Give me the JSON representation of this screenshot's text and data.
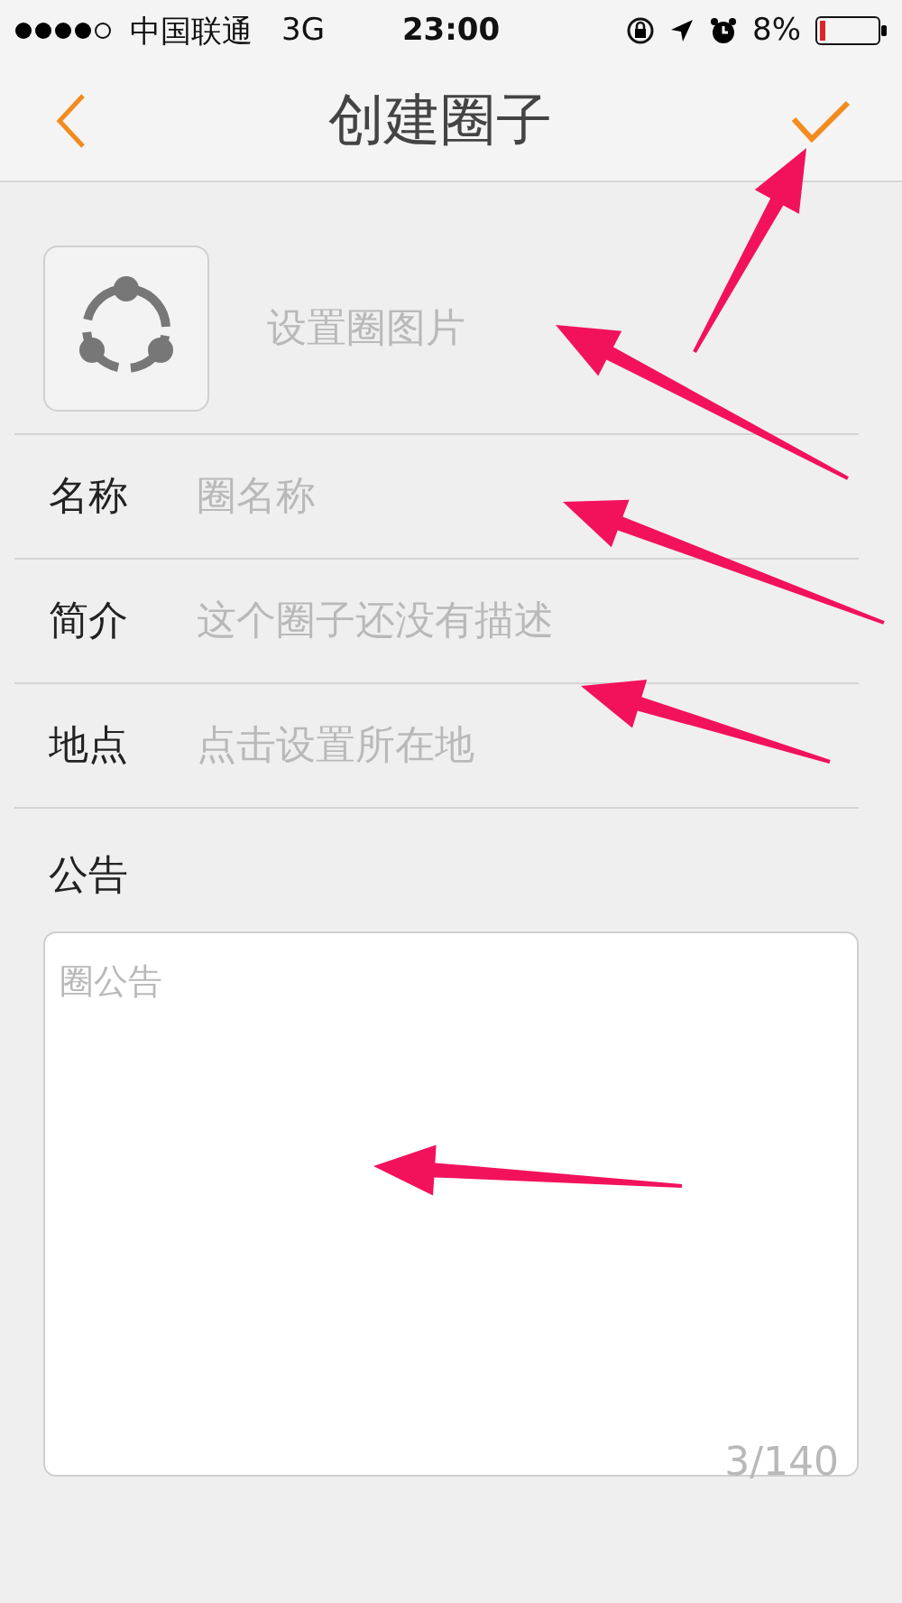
{
  "status_bar": {
    "carrier": "中国联通",
    "network": "3G",
    "time": "23:00",
    "battery": "8%"
  },
  "nav": {
    "title": "创建圈子"
  },
  "image_row": {
    "label": "设置圈图片"
  },
  "fields": [
    {
      "label": "名称",
      "placeholder": "圈名称"
    },
    {
      "label": "简介",
      "placeholder": "这个圈子还没有描述"
    },
    {
      "label": "地点",
      "placeholder": "点击设置所在地"
    }
  ],
  "notice": {
    "label": "公告",
    "placeholder": "圈公告",
    "counter": "3/140"
  }
}
